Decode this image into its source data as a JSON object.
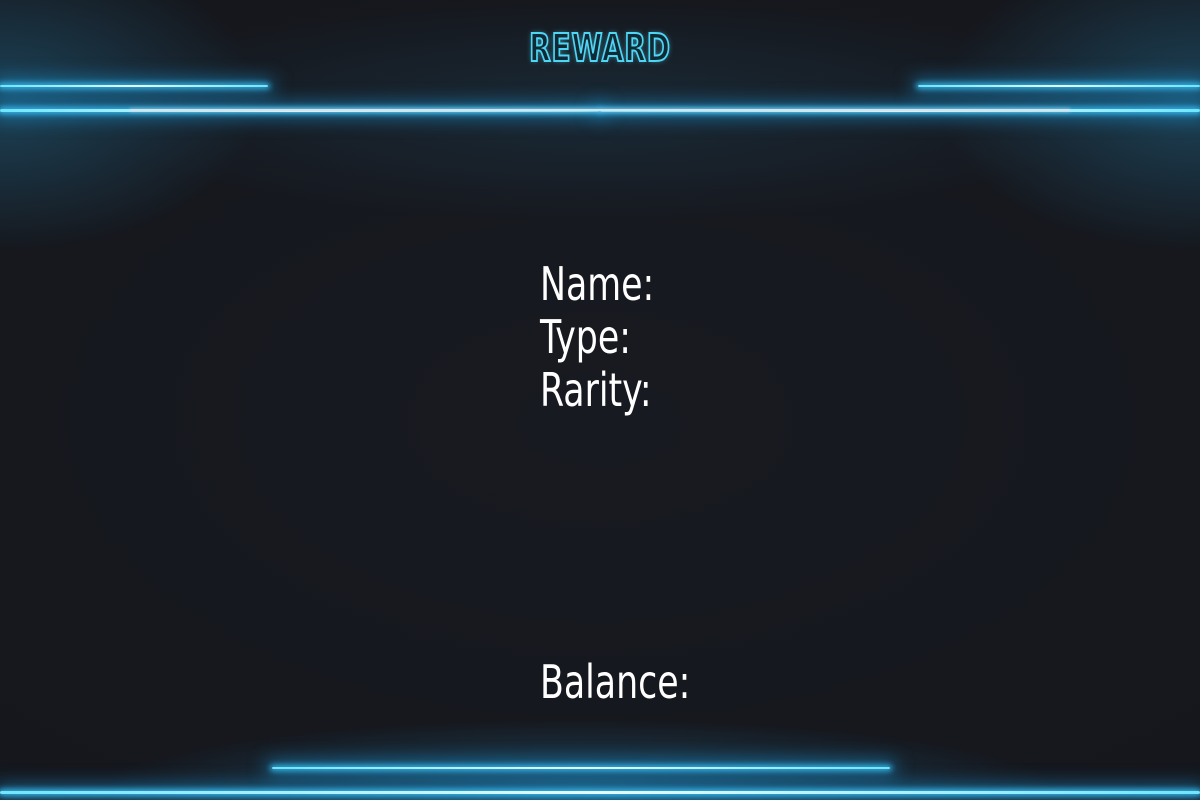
{
  "header": {
    "title": "REWARD"
  },
  "reward": {
    "name_label": "Name:",
    "type_label": "Type:",
    "rarity_label": "Rarity:"
  },
  "footer": {
    "balance_label": "Balance:"
  },
  "colors": {
    "background": "#171920",
    "neon_accent": "#4fd6f5",
    "text": "#ffffff"
  }
}
